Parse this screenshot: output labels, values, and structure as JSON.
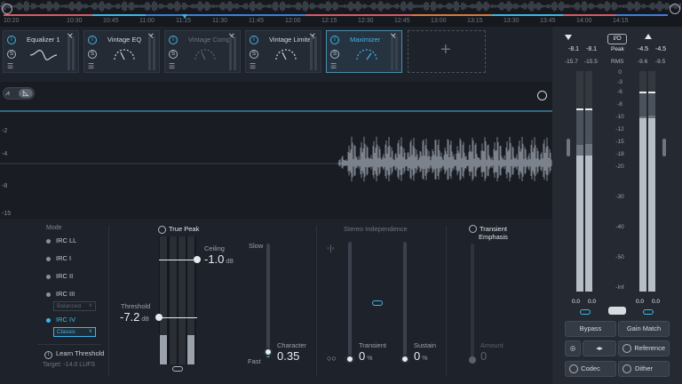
{
  "timeline": {
    "times": [
      "10:30",
      "10:45",
      "11:00",
      "11:15",
      "11:30",
      "11:45",
      "12:00",
      "12:15",
      "12:30",
      "12:45",
      "13:00",
      "13:15",
      "13:30",
      "13:45",
      "14:00",
      "14:15"
    ],
    "start_label": "10:20"
  },
  "modules": [
    {
      "name": "Equalizer 1",
      "state": "on"
    },
    {
      "name": "Vintage EQ",
      "state": "on"
    },
    {
      "name": "Vintage Comp",
      "state": "off"
    },
    {
      "name": "Vintage Limiter",
      "state": "on"
    },
    {
      "name": "Maximizer",
      "state": "selected"
    }
  ],
  "add_module_glyph": "+",
  "display": {
    "db_labels": [
      "-2",
      "-4",
      "-8",
      "-15"
    ]
  },
  "mode": {
    "title": "Mode",
    "items": [
      "IRC LL",
      "IRC I",
      "IRC II",
      "IRC III",
      "IRC IV"
    ],
    "selected": "IRC IV",
    "balanced_label": "Balanced",
    "classic_label": "Classic",
    "learn_label": "Learn Threshold",
    "target_label": "Target: -14.0 LUFS"
  },
  "true_peak": {
    "label": "True Peak",
    "ceiling_label": "Ceiling",
    "ceiling_value": "-1.0",
    "ceiling_unit": "dB",
    "threshold_label": "Threshold",
    "threshold_value": "-7.2",
    "threshold_unit": "dB"
  },
  "character": {
    "slow_label": "Slow",
    "fast_label": "Fast",
    "label": "Character",
    "value": "0.35",
    "level": 0.05
  },
  "stereo": {
    "title": "Stereo Independence",
    "transient_label": "Transient",
    "transient_value": "0",
    "sustain_label": "Sustain",
    "sustain_value": "0",
    "unit": "%"
  },
  "transient_emphasis": {
    "title_line1": "Transient",
    "title_line2": "Emphasis",
    "amount_label": "Amount",
    "amount_value": "0"
  },
  "meters": {
    "io_label": "I/O",
    "peak_label": "Peak",
    "rms_label": "RMS",
    "in_peak": [
      "-8.1",
      "-8.1"
    ],
    "in_rms": [
      "-15.7",
      "-15.5"
    ],
    "out_peak": [
      "-4.5",
      "-4.5"
    ],
    "out_rms": [
      "-9.6",
      "-9.5"
    ],
    "scale": [
      "0",
      "-3",
      "-6",
      "-8",
      "-10",
      "-12",
      "-15",
      "-18",
      "-20",
      "-30",
      "-40",
      "-50",
      "-Inf"
    ],
    "in_trim": [
      "0.0",
      "0.0"
    ],
    "out_trim": [
      "0.0",
      "0.0"
    ],
    "in_level_dB": -18,
    "out_level_dB": -10,
    "accent": "#3fb6e8"
  },
  "buttons": {
    "bypass": "Bypass",
    "gain_match": "Gain Match",
    "reference": "Reference",
    "codec": "Codec",
    "dither": "Dither"
  }
}
